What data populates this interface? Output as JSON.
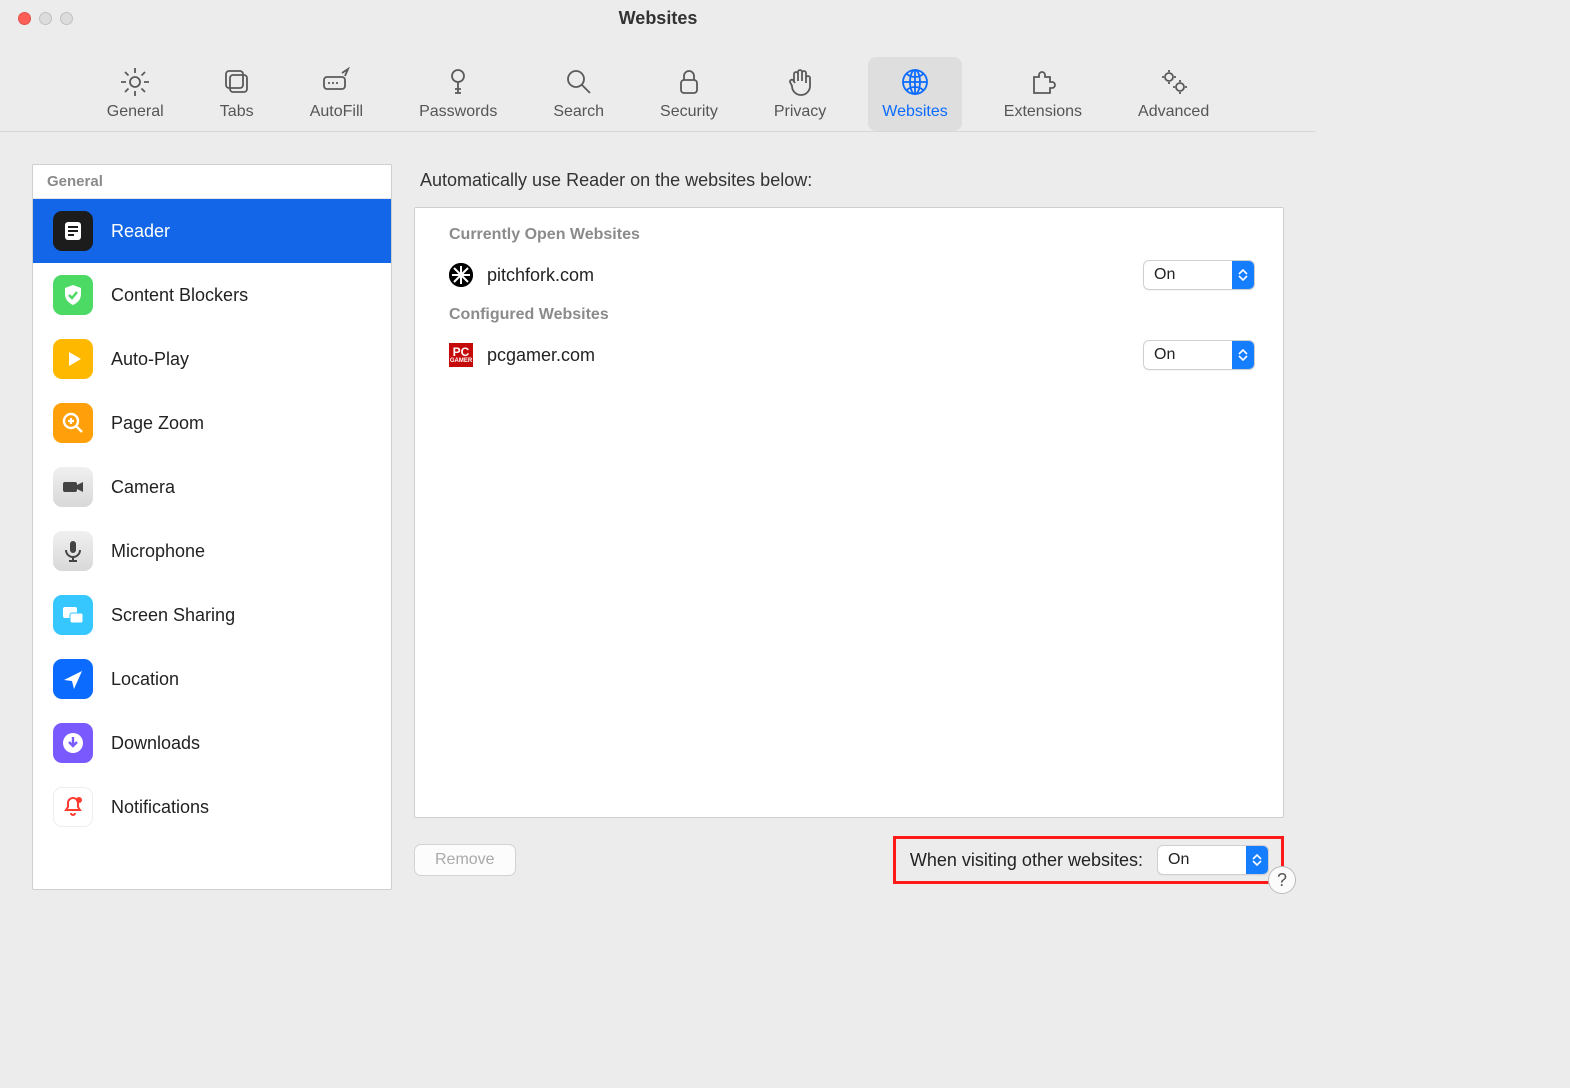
{
  "window": {
    "title": "Websites"
  },
  "toolbar": {
    "items": [
      "General",
      "Tabs",
      "AutoFill",
      "Passwords",
      "Search",
      "Security",
      "Privacy",
      "Websites",
      "Extensions",
      "Advanced"
    ],
    "selected_index": 7
  },
  "sidebar": {
    "header": "General",
    "items": [
      "Reader",
      "Content Blockers",
      "Auto-Play",
      "Page Zoom",
      "Camera",
      "Microphone",
      "Screen Sharing",
      "Location",
      "Downloads",
      "Notifications"
    ],
    "selected_index": 0
  },
  "main": {
    "intro": "Automatically use Reader on the websites below:",
    "groups": [
      {
        "title": "Currently Open Websites",
        "rows": [
          {
            "site": "pitchfork.com",
            "value": "On"
          }
        ]
      },
      {
        "title": "Configured Websites",
        "rows": [
          {
            "site": "pcgamer.com",
            "value": "On"
          }
        ]
      }
    ],
    "remove_label": "Remove",
    "default_label": "When visiting other websites:",
    "default_value": "On"
  },
  "help": "?"
}
